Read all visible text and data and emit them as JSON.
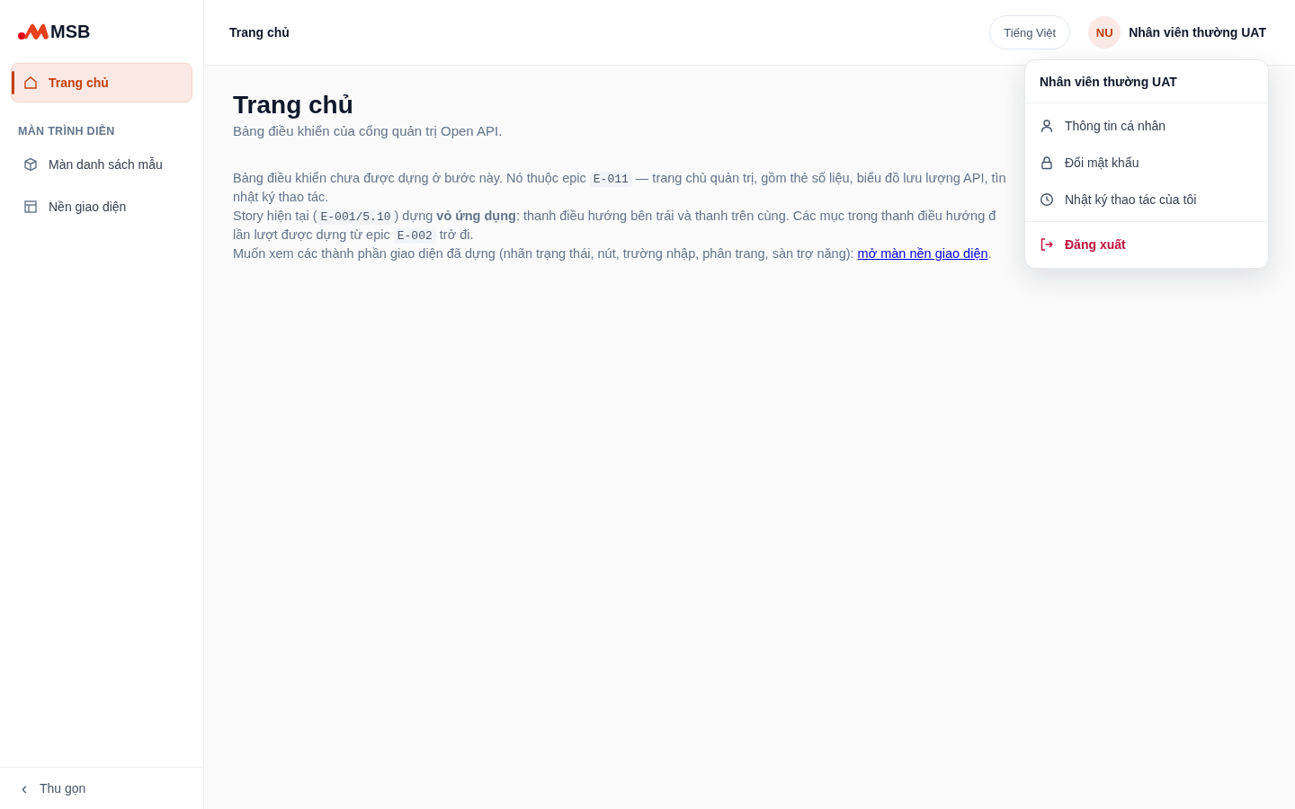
{
  "sidebar": {
    "logo": "MSB",
    "items": [
      {
        "label": "Trang chủ",
        "selected": true
      }
    ],
    "section": "MÀN TRÌNH DIỄN",
    "section_items": [
      {
        "label": "Màn danh sách mẫu",
        "selected": false
      },
      {
        "label": "Nền giao diện",
        "selected": false
      }
    ],
    "collapse": {
      "icon": "‹",
      "label": "Thu gọn"
    }
  },
  "topbar": {
    "breadcrumb": "Trang chủ",
    "language": "Tiếng Việt",
    "user": {
      "initials": "NU",
      "name": "Nhân viên thường UAT"
    }
  },
  "page": {
    "title": "Trang chủ",
    "subtitle": "Bảng điều khiển của cổng quản trị Open API.",
    "lines": [
      [
        {
          "kind": "text",
          "text": "Bảng điều khiển chưa được dựng ở bước này. Nó thuộc epic "
        },
        {
          "kind": "code",
          "text": "E-011"
        },
        {
          "kind": "text",
          "text": " — trang chủ quản trị, gồm thẻ số liệu, biểu đồ lưu lượng API, tìn"
        }
      ],
      [
        {
          "kind": "text",
          "text": "nhật ký thao tác."
        }
      ],
      [
        {
          "kind": "text",
          "text": "Story hiện tại ("
        },
        {
          "kind": "code",
          "text": "E-001/5.10"
        },
        {
          "kind": "text",
          "text": ") dựng **vỏ ứng dụng**: thanh điều hướng bên trái và thanh trên cùng. Các mục trong thanh điều hướng đ"
        }
      ],
      [
        {
          "kind": "text",
          "text": "lần lượt được dựng từ epic "
        },
        {
          "kind": "code",
          "text": "E-002"
        },
        {
          "kind": "text",
          "text": " trở đi."
        }
      ],
      [
        {
          "kind": "text",
          "text": "Muốn xem các thành phần giao diện đã dựng (nhãn trạng thái, nút, trường nhập, phân trang, sàn trợ năng): "
        },
        {
          "kind": "link",
          "text": "mở màn nền giao diện"
        },
        {
          "kind": "text",
          "text": "."
        }
      ]
    ]
  },
  "user_menu": {
    "header": "Nhân viên thường UAT",
    "items": [
      {
        "label": "Thông tin cá nhân",
        "kind": "normal"
      },
      {
        "label": "Đổi mật khẩu",
        "kind": "normal"
      },
      {
        "label": "Nhật ký thao tác của tôi",
        "kind": "normal"
      },
      {
        "label": "Đăng xuất",
        "kind": "danger"
      }
    ]
  }
}
